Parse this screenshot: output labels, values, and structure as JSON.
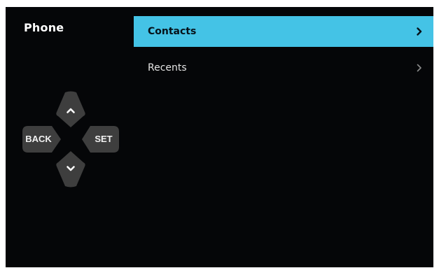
{
  "app": {
    "title": "Phone"
  },
  "menu": {
    "items": [
      {
        "label": "Contacts",
        "selected": true,
        "chevron": "chevron-right-icon"
      },
      {
        "label": "Recents",
        "selected": false,
        "chevron": "chevron-right-icon"
      }
    ]
  },
  "dpad": {
    "up_icon": "chevron-up-icon",
    "down_icon": "chevron-down-icon",
    "back_label": "BACK",
    "set_label": "SET"
  },
  "colors": {
    "background": "#050608",
    "selected": "#44c3e6",
    "button": "#3e3e3e",
    "text": "#ffffff"
  }
}
